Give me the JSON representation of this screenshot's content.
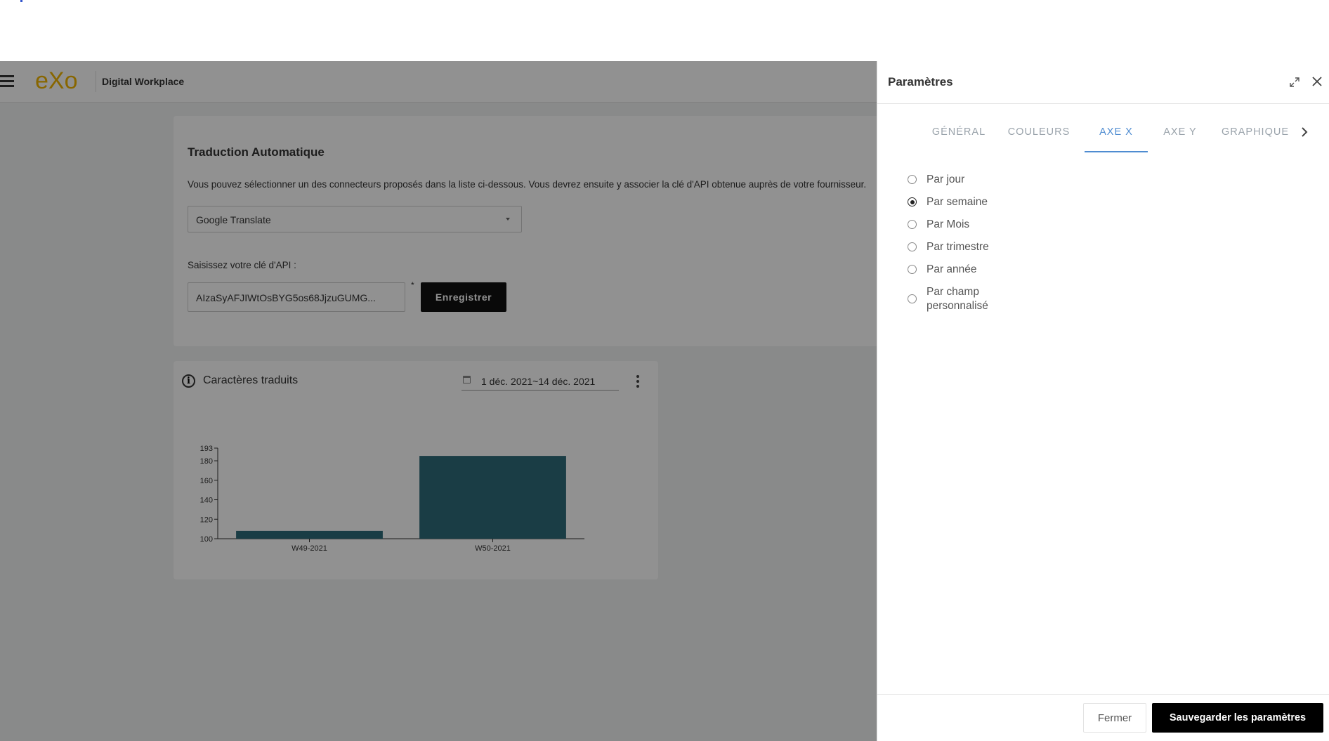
{
  "header": {
    "brand": "Digital Workplace",
    "logo_text": "eXo"
  },
  "translation_card": {
    "title": "Traduction Automatique",
    "description": "Vous pouvez sélectionner un des connecteurs proposés dans la liste ci-dessous. Vous devrez ensuite y associer la clé d'API obtenue auprès de votre fournisseur.",
    "connector_selected": "Google Translate",
    "api_label": "Saisissez votre clé d'API :",
    "api_value": "AIzaSyAFJIWtOsBYG5os68JjzuGUMG...",
    "required_mark": "*",
    "save_label": "Enregistrer"
  },
  "chart_card": {
    "title": "Caractères traduits",
    "date_range": "1 déc. 2021~14 déc. 2021",
    "info_icon": "info-icon",
    "menu_icon": "kebab-menu-icon"
  },
  "chart_data": {
    "type": "bar",
    "categories": [
      "W49-2021",
      "W50-2021"
    ],
    "values": [
      108,
      185
    ],
    "ylim": [
      100,
      193
    ],
    "yticks": [
      100,
      120,
      140,
      160,
      180,
      193
    ],
    "title": "",
    "xlabel": "",
    "ylabel": "",
    "color": "#2e6b7a",
    "grid": false,
    "legend": "none"
  },
  "drawer": {
    "title": "Paramètres",
    "tabs": [
      {
        "label": "GÉNÉRAL",
        "active": false
      },
      {
        "label": "COULEURS",
        "active": false
      },
      {
        "label": "AXE X",
        "active": true
      },
      {
        "label": "AXE Y",
        "active": false
      },
      {
        "label": "GRAPHIQUE",
        "active": false
      }
    ],
    "options": [
      {
        "label": "Par jour",
        "checked": false
      },
      {
        "label": "Par semaine",
        "checked": true
      },
      {
        "label": "Par Mois",
        "checked": false
      },
      {
        "label": "Par trimestre",
        "checked": false
      },
      {
        "label": "Par année",
        "checked": false
      },
      {
        "label": "Par champ personnalisé",
        "checked": false
      }
    ],
    "close_label": "Fermer",
    "save_label": "Sauvegarder les paramètres"
  },
  "colors": {
    "accent": "#4f8cd1",
    "bar": "#2e6b7a",
    "logo": "#f0b400"
  }
}
